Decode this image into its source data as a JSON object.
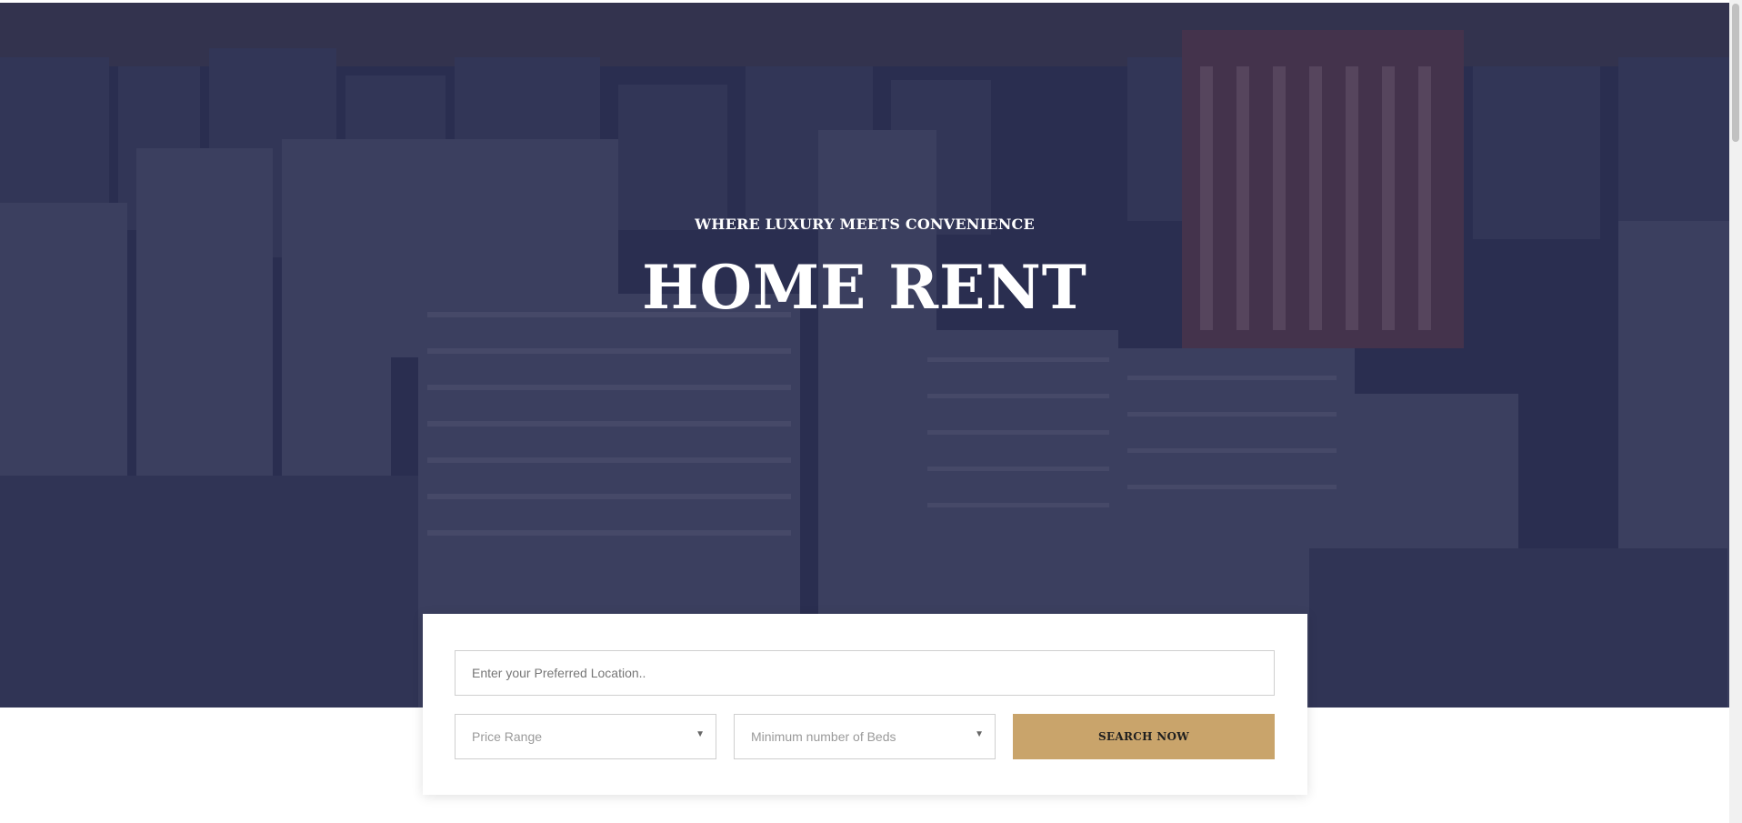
{
  "hero": {
    "subtitle": "WHERE LUXURY MEETS CONVENIENCE",
    "title": "HOME RENT"
  },
  "search": {
    "location_placeholder": "Enter your Preferred Location..",
    "price_range_label": "Price Range",
    "beds_label": "Minimum number of Beds",
    "button_label": "SEARCH NOW"
  },
  "colors": {
    "accent": "#c9a46b",
    "overlay": "#1e2242"
  },
  "icons": {
    "dropdown": "chevron-down-icon"
  }
}
